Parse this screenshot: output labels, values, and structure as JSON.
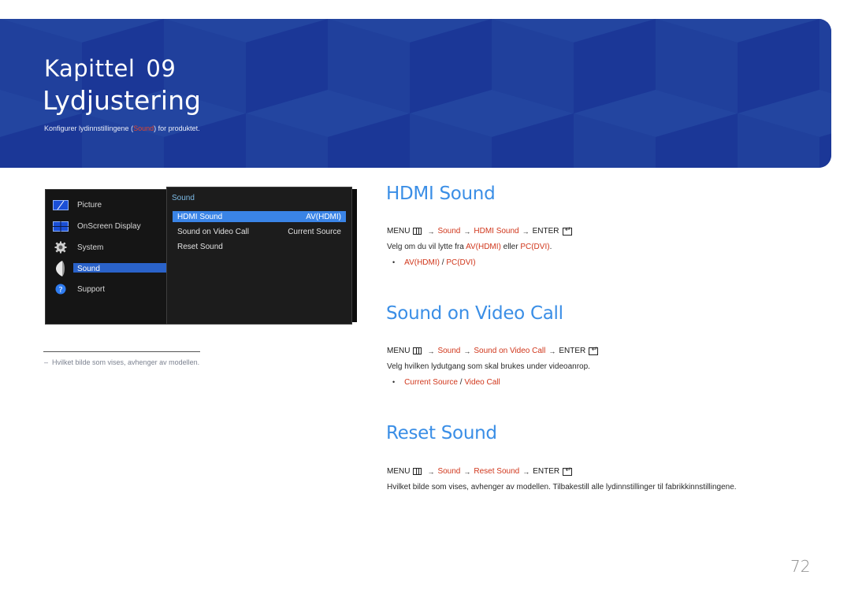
{
  "banner": {
    "chapter_label": "Kapittel",
    "chapter_number": "09",
    "title": "Lydjustering",
    "subtitle_before": "Konfigurer lydinnstillingene (",
    "subtitle_highlight": "Sound",
    "subtitle_after": ") for produktet.",
    "background_color": "#1f3d9a"
  },
  "osd": {
    "left_menu": [
      {
        "label": "Picture",
        "icon": "picture-icon"
      },
      {
        "label": "OnScreen Display",
        "icon": "onscreen-display-icon"
      },
      {
        "label": "System",
        "icon": "gear-icon"
      },
      {
        "label": "Sound",
        "icon": "speaker-icon",
        "active": true
      },
      {
        "label": "Support",
        "icon": "question-icon"
      }
    ],
    "panel_title": "Sound",
    "items": [
      {
        "label": "HDMI Sound",
        "value": "AV(HDMI)",
        "active": true
      },
      {
        "label": "Sound on Video Call",
        "value": "Current Source"
      },
      {
        "label": "Reset Sound",
        "value": ""
      }
    ]
  },
  "footnote": {
    "dash": "–",
    "text": "Hvilket bilde som vises, avhenger av modellen."
  },
  "sections": [
    {
      "heading": "HDMI Sound",
      "path": {
        "menu": "MENU",
        "steps": [
          "Sound",
          "HDMI Sound"
        ],
        "enter": "ENTER"
      },
      "desc_parts": [
        "Velg om du vil lytte fra ",
        "AV(HDMI)",
        " eller ",
        "PC(DVI)",
        "."
      ],
      "options": [
        "AV(HDMI)",
        "PC(DVI)"
      ],
      "separator": " / "
    },
    {
      "heading": "Sound on Video Call",
      "path": {
        "menu": "MENU",
        "steps": [
          "Sound",
          "Sound on Video Call"
        ],
        "enter": "ENTER"
      },
      "desc": "Velg hvilken lydutgang som skal brukes under videoanrop.",
      "options": [
        "Current Source",
        "Video Call"
      ],
      "separator": " / "
    },
    {
      "heading": "Reset Sound",
      "path": {
        "menu": "MENU",
        "steps": [
          "Sound",
          "Reset Sound"
        ],
        "enter": "ENTER"
      },
      "desc": "Hvilket bilde som vises, avhenger av modellen. Tilbakestill alle lydinnstillinger til fabrikkinnstillingene."
    }
  ],
  "page_number": "72",
  "colors": {
    "heading_blue": "#3a8ee6",
    "link_red": "#d0361b",
    "osd_highlight": "#3a84e6"
  },
  "symbols": {
    "arrow": "→",
    "bullet": "•"
  }
}
